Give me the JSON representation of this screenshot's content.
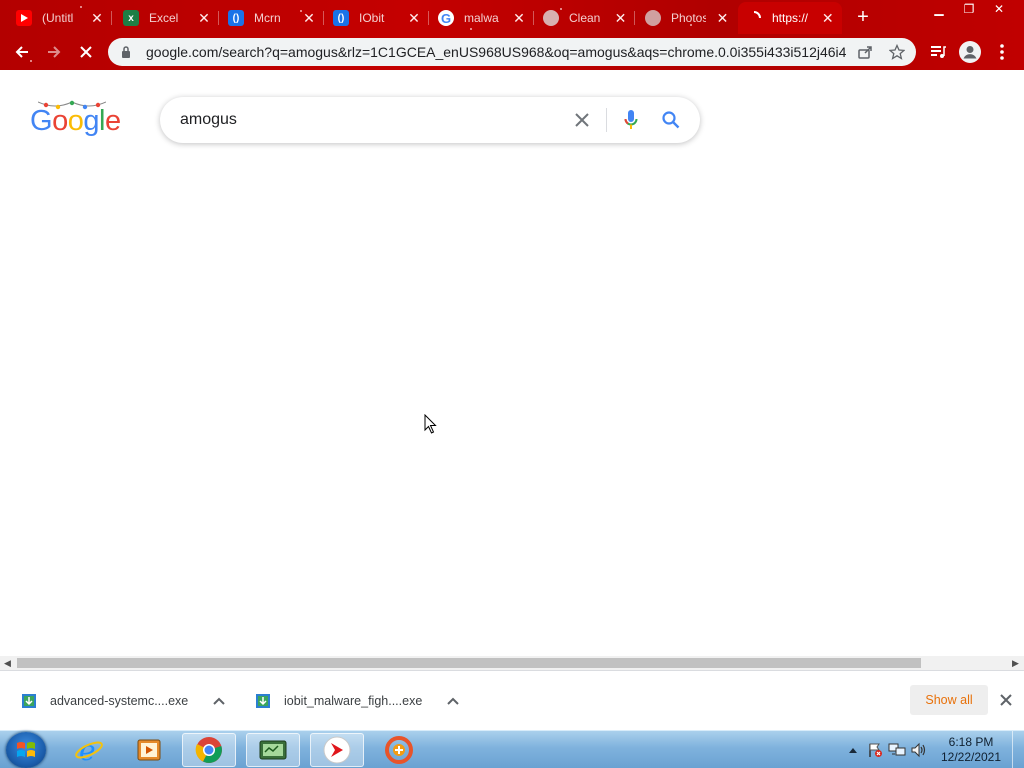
{
  "browser": {
    "tabs": [
      {
        "title": "(Untitl",
        "favicon": "youtube-icon",
        "color": "#ff0000"
      },
      {
        "title": "Excel",
        "favicon": "sheets-icon",
        "color": "#1e7e45"
      },
      {
        "title": "Mcrn",
        "favicon": "iobit-icon",
        "color": "#1a73e8"
      },
      {
        "title": "IObit",
        "favicon": "iobit-icon",
        "color": "#1a73e8"
      },
      {
        "title": "malwa",
        "favicon": "google-icon",
        "color": "#ffffff"
      },
      {
        "title": "Clean",
        "favicon": "page-icon",
        "color": "#c0c0c0"
      },
      {
        "title": "Photos",
        "favicon": "page-icon",
        "color": "#c0c0c0"
      },
      {
        "title": "https://",
        "favicon": "loading-icon",
        "color": "#ffffff"
      }
    ],
    "url": "google.com/search?q=amogus&rlz=1C1GCEA_enUS968US968&oq=amogus&aqs=chrome.0.0i355i433i512j46i4..."
  },
  "google": {
    "logo_letters": [
      "G",
      "o",
      "o",
      "g",
      "l",
      "e"
    ],
    "query": "amogus"
  },
  "downloads": {
    "items": [
      {
        "name": "advanced-systemc....exe"
      },
      {
        "name": "iobit_malware_figh....exe"
      }
    ],
    "show_all": "Show all"
  },
  "taskbar": {
    "time": "6:18 PM",
    "date": "12/22/2021"
  },
  "colors": {
    "chrome_theme": "#c00000",
    "google_blue": "#4285f4",
    "google_red": "#ea4335",
    "google_yellow": "#fbbc05",
    "google_green": "#34a853",
    "show_all_text": "#e8710a"
  }
}
